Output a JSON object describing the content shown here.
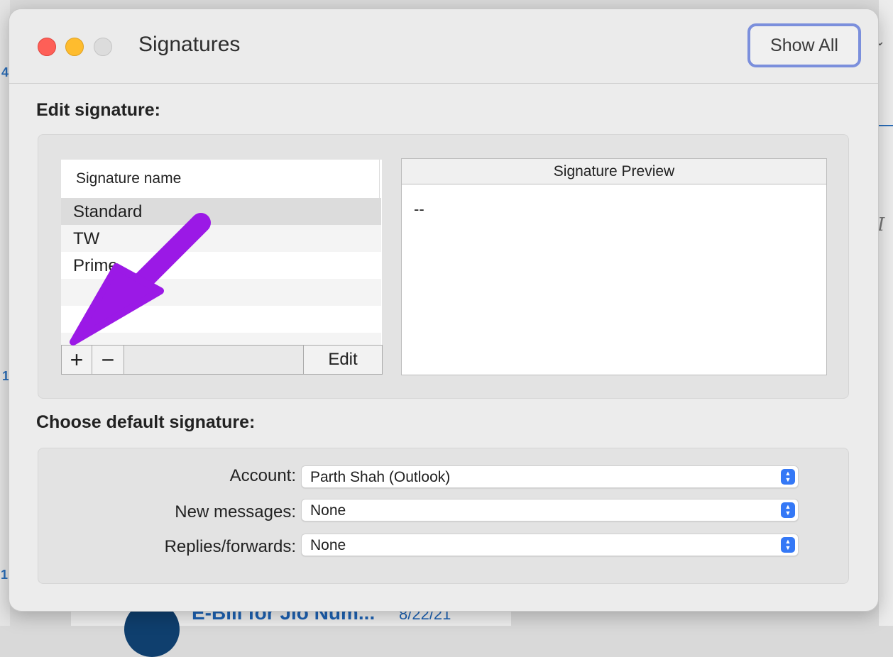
{
  "window": {
    "title": "Signatures",
    "show_all_label": "Show All"
  },
  "edit_section": {
    "heading": "Edit signature:",
    "list_header": "Signature name",
    "signatures": [
      "Standard",
      "TW",
      "Prime"
    ],
    "selected_index": 0,
    "add_label": "+",
    "remove_label": "−",
    "edit_label": "Edit",
    "preview_header": "Signature Preview",
    "preview_text": "--"
  },
  "default_section": {
    "heading": "Choose default signature:",
    "account_label": "Account:",
    "account_value": "Parth Shah (Outlook)",
    "new_messages_label": "New messages:",
    "new_messages_value": "None",
    "replies_label": "Replies/forwards:",
    "replies_value": "None"
  },
  "background": {
    "email_title": "E-Bill for Jio Num...",
    "email_date": "8/22/21",
    "side_numbers": [
      "4",
      "1",
      "1"
    ]
  },
  "colors": {
    "accent": "#3478f6",
    "show_all_focus": "#7b8fdc",
    "annotation_arrow": "#9b19e6"
  }
}
